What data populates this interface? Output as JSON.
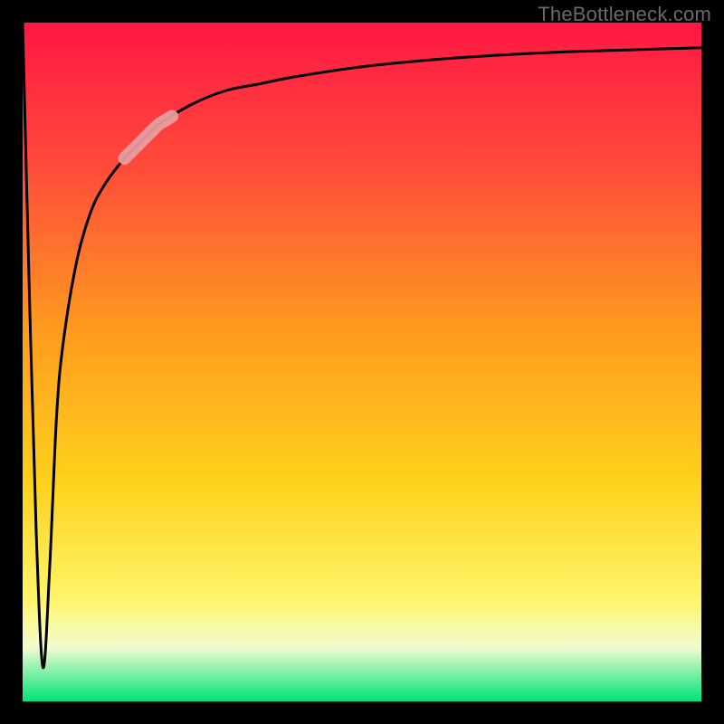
{
  "watermark": "TheBottleneck.com",
  "colors": {
    "frame": "#000000",
    "curve": "#000000",
    "highlight": "#e9a0a4",
    "gradient_stops": [
      {
        "offset": 0.0,
        "hex": "#ff1744"
      },
      {
        "offset": 0.22,
        "hex": "#ff4d3a"
      },
      {
        "offset": 0.45,
        "hex": "#ff9a1f"
      },
      {
        "offset": 0.68,
        "hex": "#ffd21c"
      },
      {
        "offset": 0.85,
        "hex": "#fff56b"
      },
      {
        "offset": 0.92,
        "hex": "#f2fccf"
      },
      {
        "offset": 1.0,
        "hex": "#00e37a"
      }
    ]
  },
  "chart_data": {
    "type": "line",
    "title": "",
    "xlabel": "",
    "ylabel": "",
    "xlim": [
      0,
      100
    ],
    "ylim": [
      0,
      100
    ],
    "x": [
      0,
      1,
      2,
      3,
      4,
      5,
      6,
      8,
      10,
      12,
      15,
      18,
      20,
      25,
      30,
      35,
      40,
      50,
      60,
      70,
      80,
      90,
      100
    ],
    "y": [
      100,
      60,
      25,
      5,
      20,
      42,
      53,
      65,
      72,
      76,
      80,
      83,
      85,
      88,
      90,
      91,
      92,
      93.5,
      94.5,
      95.2,
      95.7,
      96.0,
      96.3
    ],
    "highlight_x_range": [
      15,
      22
    ],
    "annotations": []
  }
}
